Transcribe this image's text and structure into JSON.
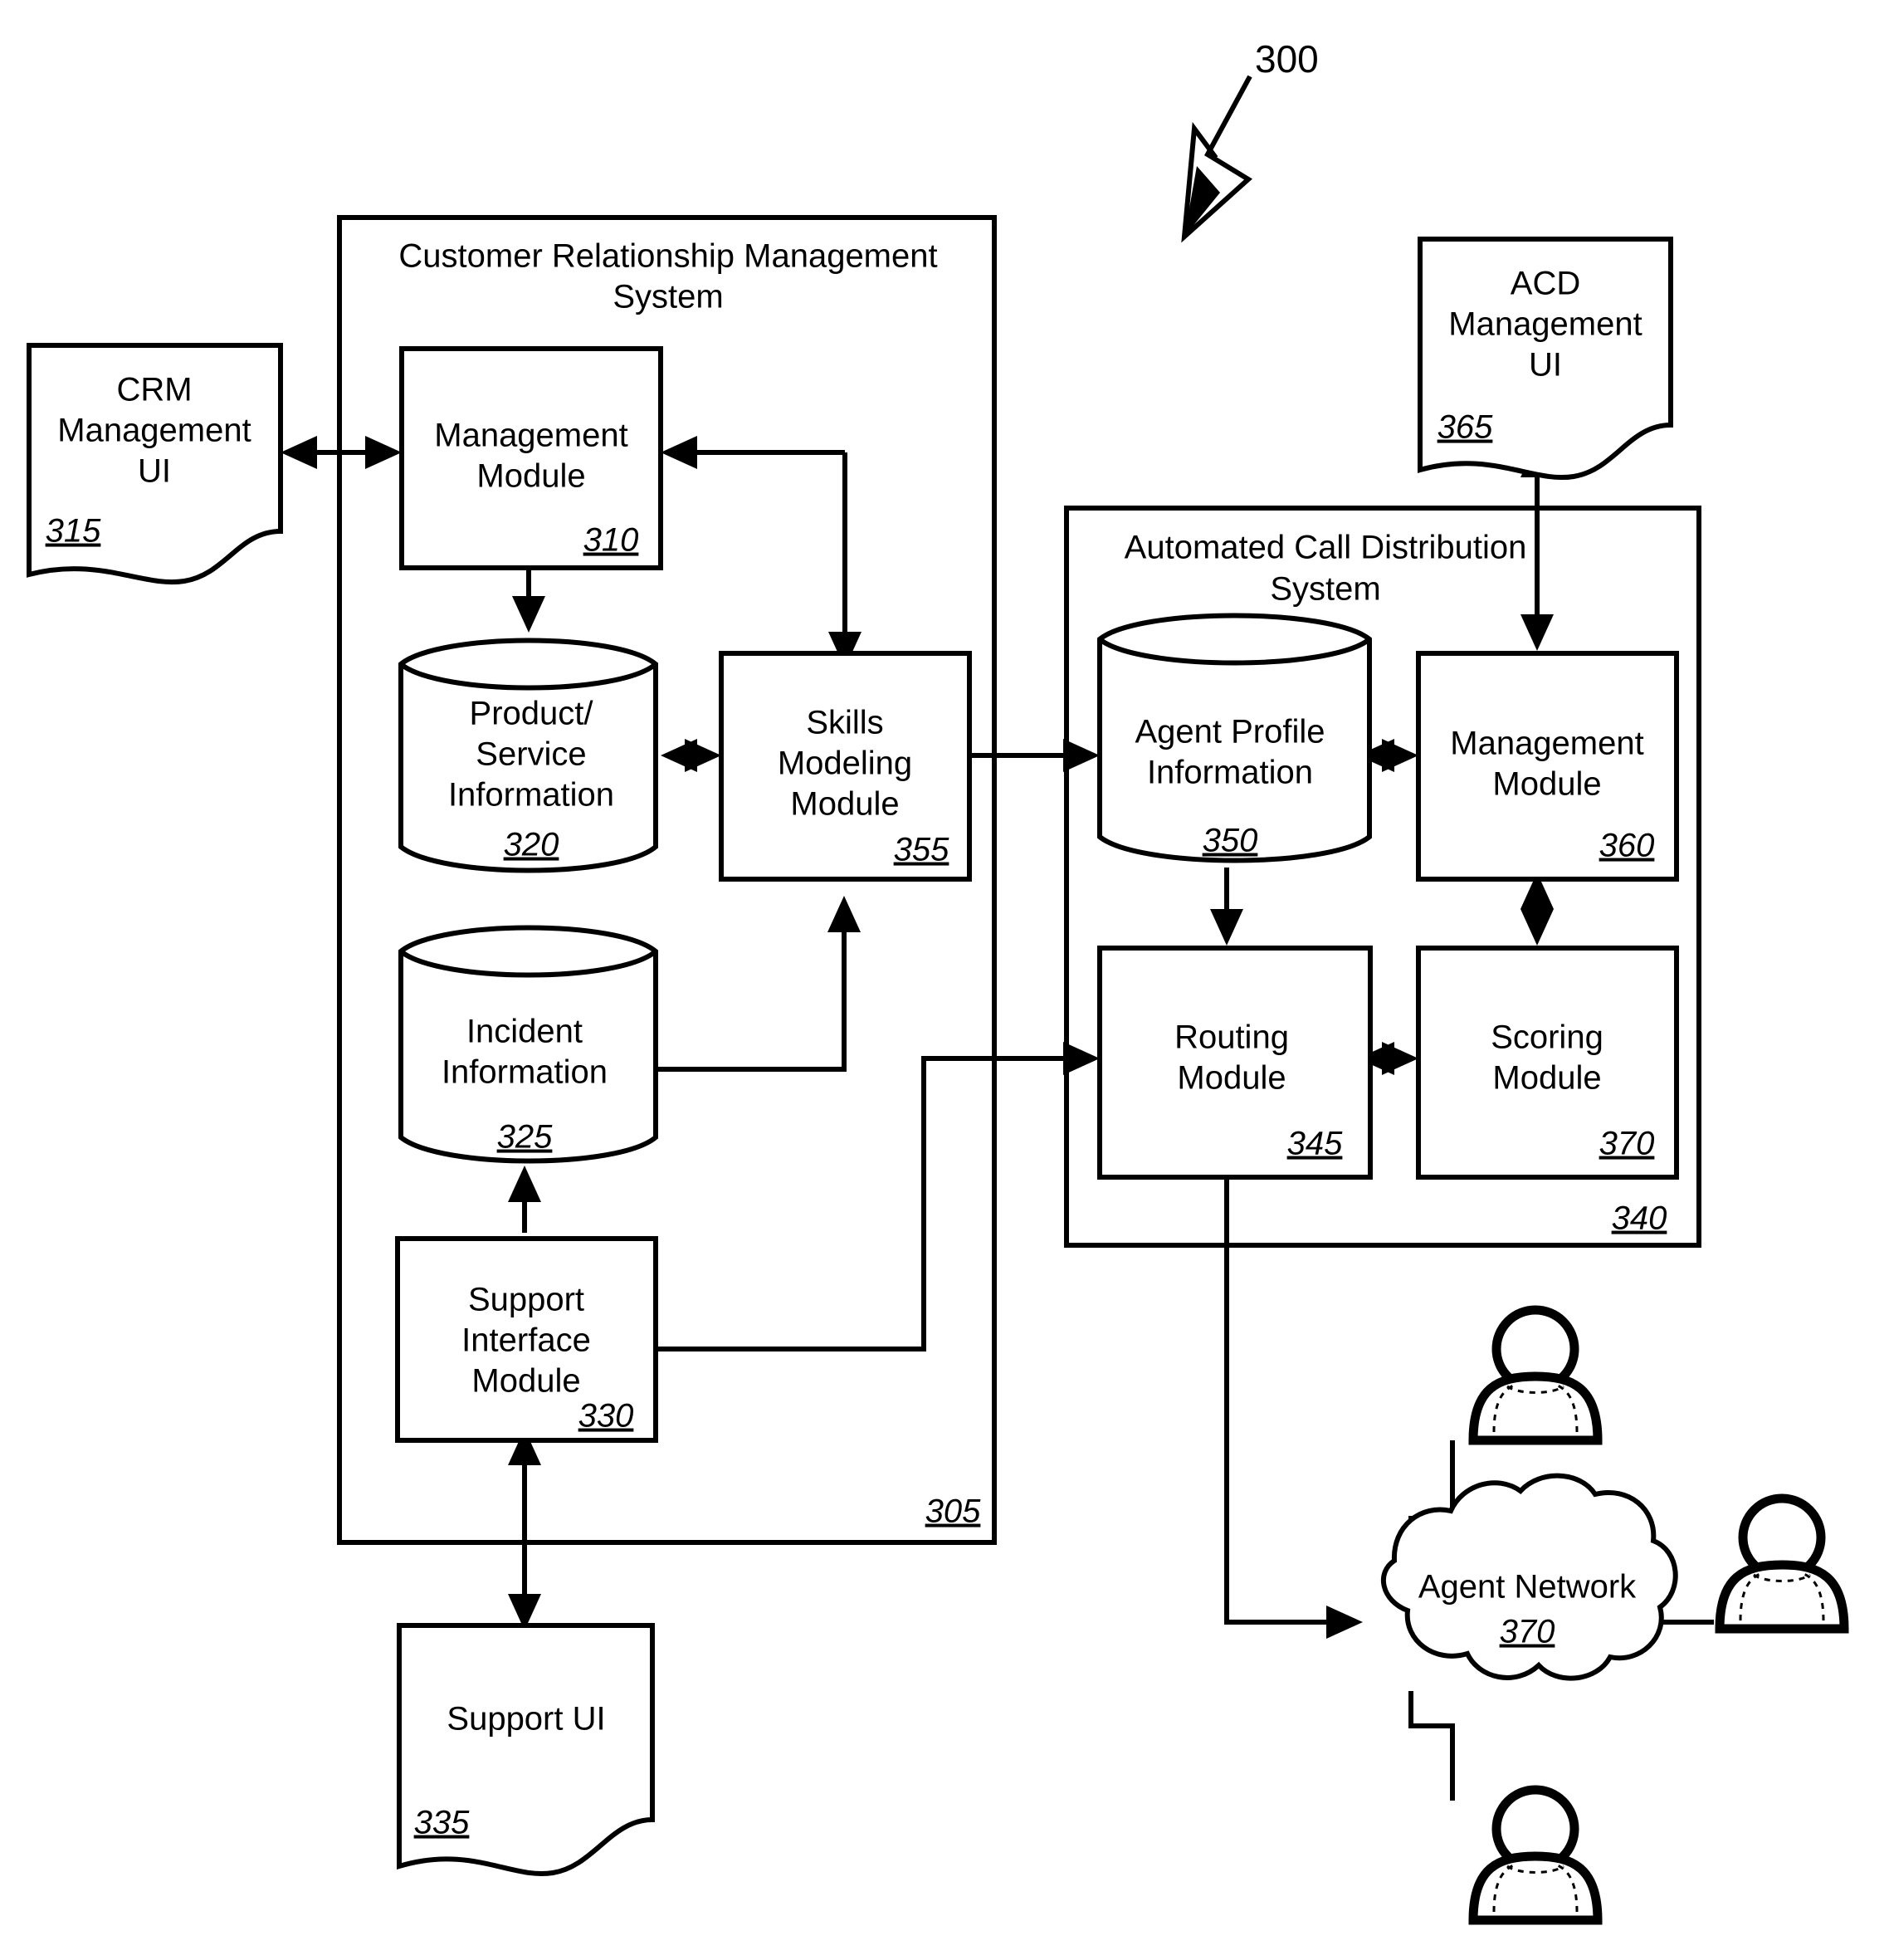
{
  "figure": {
    "number": "300",
    "number_name": "figure-reference-300"
  },
  "containers": [
    {
      "id": "crm-system",
      "title_line1": "Customer Relationship Management",
      "title_line2": "System",
      "ref": "305"
    },
    {
      "id": "acd-system",
      "title_line1": "Automated Call Distribution",
      "title_line2": "System",
      "ref": "340"
    }
  ],
  "nodes": {
    "crm_management_ui": {
      "line1": "CRM",
      "line2": "Management",
      "line3": "UI",
      "ref": "315",
      "shape": "document"
    },
    "management_module_310": {
      "line1": "Management",
      "line2": "Module",
      "ref": "310",
      "shape": "rect"
    },
    "product_service_info": {
      "line1": "Product/",
      "line2": "Service",
      "line3": "Information",
      "ref": "320",
      "shape": "cylinder"
    },
    "skills_modeling_module": {
      "line1": "Skills",
      "line2": "Modeling",
      "line3": "Module",
      "ref": "355",
      "shape": "rect"
    },
    "incident_information": {
      "line1": "Incident",
      "line2": "Information",
      "ref": "325",
      "shape": "cylinder"
    },
    "support_interface_module": {
      "line1": "Support",
      "line2": "Interface",
      "line3": "Module",
      "ref": "330",
      "shape": "rect"
    },
    "support_ui": {
      "line1": "Support UI",
      "ref": "335",
      "shape": "document"
    },
    "acd_management_ui": {
      "line1": "ACD",
      "line2": "Management",
      "line3": "UI",
      "ref": "365",
      "shape": "document"
    },
    "agent_profile_information": {
      "line1": "Agent Profile",
      "line2": "Information",
      "ref": "350",
      "shape": "cylinder"
    },
    "management_module_360": {
      "line1": "Management",
      "line2": "Module",
      "ref": "360",
      "shape": "rect"
    },
    "routing_module": {
      "line1": "Routing",
      "line2": "Module",
      "ref": "345",
      "shape": "rect"
    },
    "scoring_module": {
      "line1": "Scoring",
      "line2": "Module",
      "ref": "370",
      "shape": "rect"
    },
    "agent_network": {
      "line1": "Agent Network",
      "ref": "370",
      "shape": "cloud"
    }
  },
  "agents": [
    {
      "id": "agent-top",
      "label": "agent-person-top"
    },
    {
      "id": "agent-right",
      "label": "agent-person-right"
    },
    {
      "id": "agent-bottom",
      "label": "agent-person-bottom"
    }
  ],
  "colors": {
    "stroke": "#000000",
    "fill": "#ffffff"
  }
}
